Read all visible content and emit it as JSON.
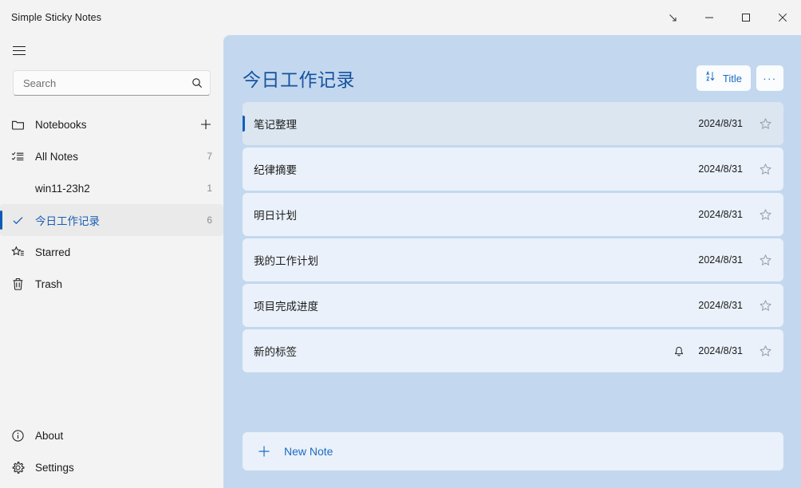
{
  "window": {
    "app_title": "Simple Sticky Notes",
    "controls": [
      {
        "name": "collapse-button",
        "icon": "arrow-down-right-icon"
      },
      {
        "name": "minimize-button",
        "icon": "minimize-icon"
      },
      {
        "name": "maximize-button",
        "icon": "maximize-icon"
      },
      {
        "name": "close-button",
        "icon": "close-icon"
      }
    ]
  },
  "sidebar": {
    "menu_icon": "hamburger-icon",
    "search": {
      "placeholder": "Search",
      "value": "",
      "icon": "search-icon"
    },
    "items": [
      {
        "label": "Notebooks",
        "icon": "folder-icon",
        "count": "",
        "action_icon": "plus-icon",
        "selected": false
      },
      {
        "label": "All Notes",
        "icon": "checklist-icon",
        "count": "7",
        "selected": false
      },
      {
        "label": "win11-23h2",
        "icon": "",
        "count": "1",
        "selected": false
      },
      {
        "label": "今日工作记录",
        "icon": "check-icon",
        "count": "6",
        "selected": true
      },
      {
        "label": "Starred",
        "icon": "star-list-icon",
        "count": "",
        "selected": false
      },
      {
        "label": "Trash",
        "icon": "trash-icon",
        "count": "",
        "selected": false
      }
    ],
    "bottom_items": [
      {
        "label": "About",
        "icon": "info-icon"
      },
      {
        "label": "Settings",
        "icon": "gear-icon"
      }
    ]
  },
  "main": {
    "title": "今日工作记录",
    "sort_button": {
      "label": "Title",
      "icon": "sort-az-icon"
    },
    "more_button": {
      "label": "···",
      "icon": "more-icon"
    },
    "notes": [
      {
        "title": "笔记整理",
        "date": "2024/8/31",
        "reminder": false,
        "starred": false,
        "selected": true
      },
      {
        "title": "纪律摘要",
        "date": "2024/8/31",
        "reminder": false,
        "starred": false,
        "selected": false
      },
      {
        "title": "明日计划",
        "date": "2024/8/31",
        "reminder": false,
        "starred": false,
        "selected": false
      },
      {
        "title": "我的工作计划",
        "date": "2024/8/31",
        "reminder": false,
        "starred": false,
        "selected": false
      },
      {
        "title": "项目完成进度",
        "date": "2024/8/31",
        "reminder": false,
        "starred": false,
        "selected": false
      },
      {
        "title": "新的标签",
        "date": "2024/8/31",
        "reminder": true,
        "starred": false,
        "selected": false
      }
    ],
    "new_note": {
      "label": "New Note",
      "icon": "plus-icon"
    }
  },
  "colors": {
    "accent": "#1b6cc0",
    "panel_bg": "#c3d8ef",
    "row_bg": "#eaf1fa",
    "row_selected_bg": "#dce6f1",
    "sidebar_bg": "#f3f3f3",
    "title_text": "#17529e"
  }
}
